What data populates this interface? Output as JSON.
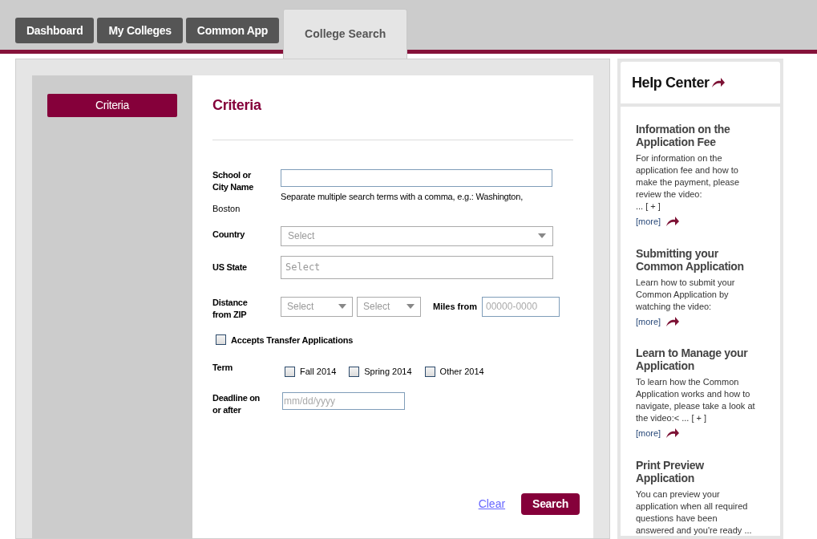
{
  "tabs": [
    {
      "label": "Dashboard",
      "selected": false
    },
    {
      "label": "My Colleges",
      "selected": false
    },
    {
      "label": "Common App",
      "selected": false
    },
    {
      "label": "College Search",
      "selected": true
    }
  ],
  "sidebar": {
    "items": [
      {
        "label": "Criteria",
        "selected": true
      }
    ]
  },
  "form": {
    "title": "Criteria",
    "school": {
      "label": "School or City Name",
      "hint": "Separate multiple search terms with a comma, e.g.: Washington,",
      "hint_continued": "Boston"
    },
    "country": {
      "label": "Country",
      "placeholder": "Select"
    },
    "us_state": {
      "label": "US State",
      "placeholder": "Select"
    },
    "distance": {
      "label": "Distance from ZIP",
      "selects": [
        "Select",
        "Select"
      ],
      "miles_label": "Miles from",
      "zip_placeholder": "00000-0000"
    },
    "transfer": {
      "label": "Accepts Transfer Applications",
      "checked": false
    },
    "term": {
      "label": "Term",
      "options": [
        {
          "label": "Fall 2014",
          "checked": false
        },
        {
          "label": "Spring 2014",
          "checked": false
        },
        {
          "label": "Other 2014",
          "checked": false
        }
      ]
    },
    "deadline": {
      "label": "Deadline on or after",
      "placeholder": "mm/dd/yyyy"
    },
    "clear": "Clear",
    "search": "Search"
  },
  "help": {
    "title": "Help Center",
    "items": [
      {
        "title": "Information on the Application Fee",
        "body": "For information on the application fee and how to make the payment, please review the video:",
        "expand": "... [ + ]",
        "more": "[more]"
      },
      {
        "title": "Submitting your Common Application",
        "body": "Learn how to submit your Common Application by watching the video:",
        "more": "[more]"
      },
      {
        "title": "Learn to Manage your Application",
        "body": "To learn how the Common Application works and how to navigate, please take a look at the video:< ... [ + ]",
        "more": "[more]"
      },
      {
        "title": "Print Preview Application",
        "body": "You can preview your application when all required questions have been answered and you're ready ..."
      }
    ]
  }
}
